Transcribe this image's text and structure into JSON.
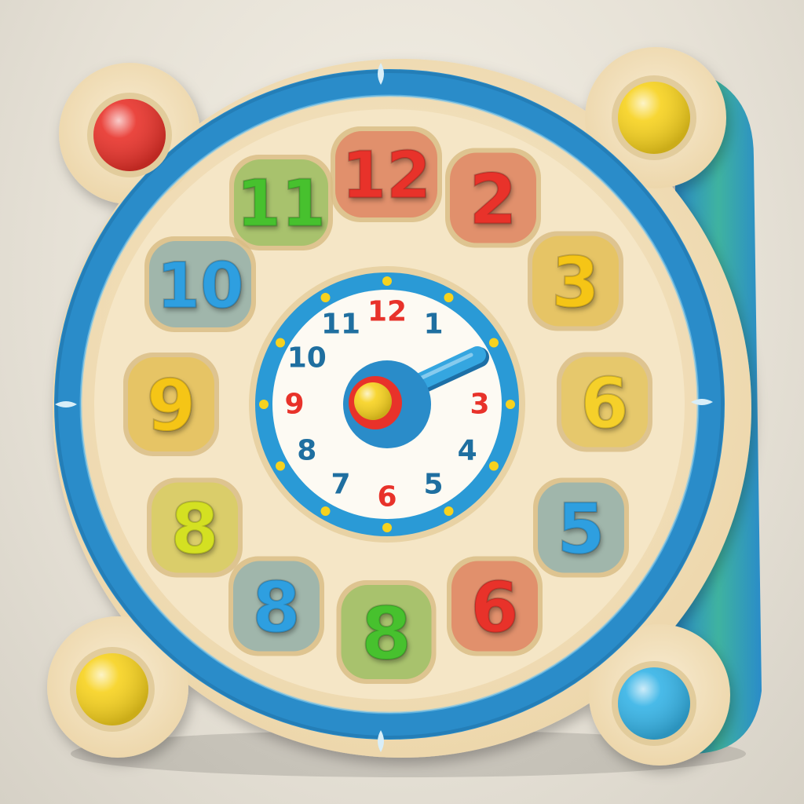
{
  "corner_buttons": [
    {
      "id": "top-left",
      "color": "#e8322a"
    },
    {
      "id": "top-right",
      "color": "#f7d21e"
    },
    {
      "id": "bottom-left",
      "color": "#f7d21e"
    },
    {
      "id": "bottom-right",
      "color": "#35b3e6"
    }
  ],
  "puzzle_pieces": [
    {
      "label": "12",
      "color": "#e8322a"
    },
    {
      "label": "2",
      "color": "#e8322a"
    },
    {
      "label": "3",
      "color": "#f5c518"
    },
    {
      "label": "6",
      "color": "#f5d02a"
    },
    {
      "label": "5",
      "color": "#2f9fe0"
    },
    {
      "label": "6",
      "color": "#e8322a"
    },
    {
      "label": "8",
      "color": "#46c12e"
    },
    {
      "label": "8",
      "color": "#2f9fe0"
    },
    {
      "label": "8",
      "color": "#d4e024"
    },
    {
      "label": "9",
      "color": "#f5c518"
    },
    {
      "label": "10",
      "color": "#2f9fe0"
    },
    {
      "label": "11",
      "color": "#46c12e"
    }
  ],
  "dial_numbers": [
    {
      "label": "12",
      "color": "#e8322a"
    },
    {
      "label": "1",
      "color": "#1f6fa0"
    },
    {
      "label": "3",
      "color": "#e8322a"
    },
    {
      "label": "4",
      "color": "#1f6fa0"
    },
    {
      "label": "5",
      "color": "#1f6fa0"
    },
    {
      "label": "6",
      "color": "#e8322a"
    },
    {
      "label": "7",
      "color": "#1f6fa0"
    },
    {
      "label": "8",
      "color": "#1f6fa0"
    },
    {
      "label": "9",
      "color": "#e8322a"
    },
    {
      "label": "10",
      "color": "#1f6fa0"
    },
    {
      "label": "11",
      "color": "#1f6fa0"
    }
  ],
  "colors": {
    "rim_blue": "#2a8cc9",
    "wood": "#f2e2c0",
    "dial_ring": "#2a9ad6",
    "dial_face": "#fdfaf3",
    "hand": "#35a6e0",
    "hub_red": "#e8322a",
    "hub_yellow": "#f7d21e"
  }
}
